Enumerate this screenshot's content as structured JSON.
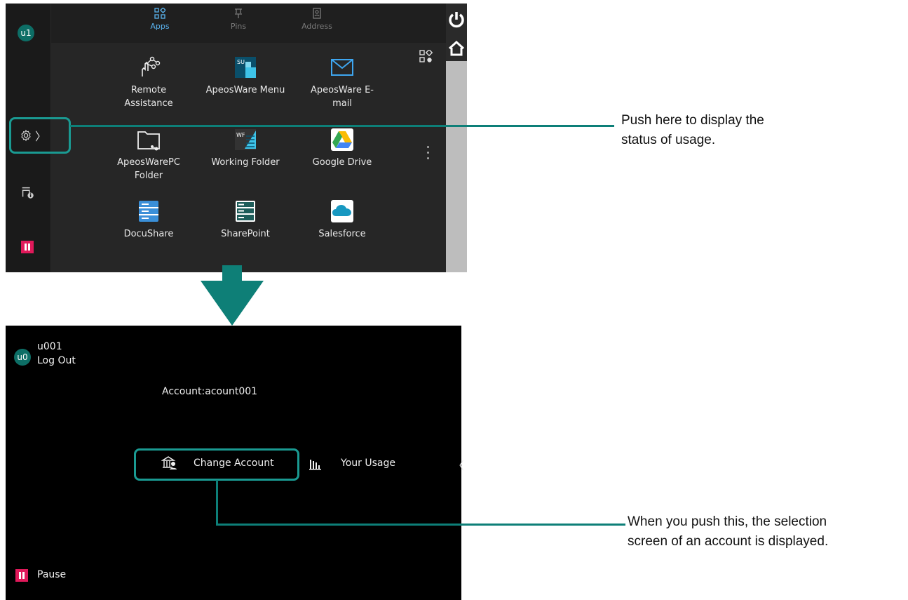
{
  "top": {
    "user_avatar": "u1",
    "tabs": [
      {
        "label": "Apps",
        "icon": "apps-grid-icon",
        "active": true
      },
      {
        "label": "Pins",
        "icon": "pin-icon",
        "active": false
      },
      {
        "label": "Address",
        "icon": "address-book-icon",
        "active": false
      }
    ],
    "apps": [
      {
        "label": "Remote\nAssistance",
        "icon": "remote-assistance-icon"
      },
      {
        "label": "ApeosWare Menu",
        "icon": "apeosware-menu-icon",
        "badge": "SU"
      },
      {
        "label": "ApeosWare E-\nmail",
        "icon": "email-icon"
      },
      {
        "label": "ApeosWarePC\nFolder",
        "icon": "pc-folder-icon"
      },
      {
        "label": "Working Folder",
        "icon": "working-folder-icon",
        "badge": "WF"
      },
      {
        "label": "Google Drive",
        "icon": "google-drive-icon"
      },
      {
        "label": "DocuShare",
        "icon": "docushare-icon"
      },
      {
        "label": "SharePoint",
        "icon": "sharepoint-icon"
      },
      {
        "label": "Salesforce",
        "icon": "salesforce-icon"
      }
    ],
    "settings_chevron": "〉"
  },
  "bottom": {
    "user_avatar": "u0",
    "user_id": "u001",
    "logout_label": "Log Out",
    "account_label": "Account:acount001",
    "change_account_label": "Change Account",
    "your_usage_label": "Your Usage",
    "collapse_chevron": "〈",
    "pause_label": "Pause"
  },
  "callouts": {
    "top": "Push here to display the\nstatus of usage.",
    "bottom": "When you push this, the selection\nscreen of an account is displayed."
  },
  "colors": {
    "teal_highlight": "#1a9a92",
    "active_tab": "#5ab4f0",
    "pause_red": "#e0195a",
    "avatar_green": "#0d6e66"
  }
}
